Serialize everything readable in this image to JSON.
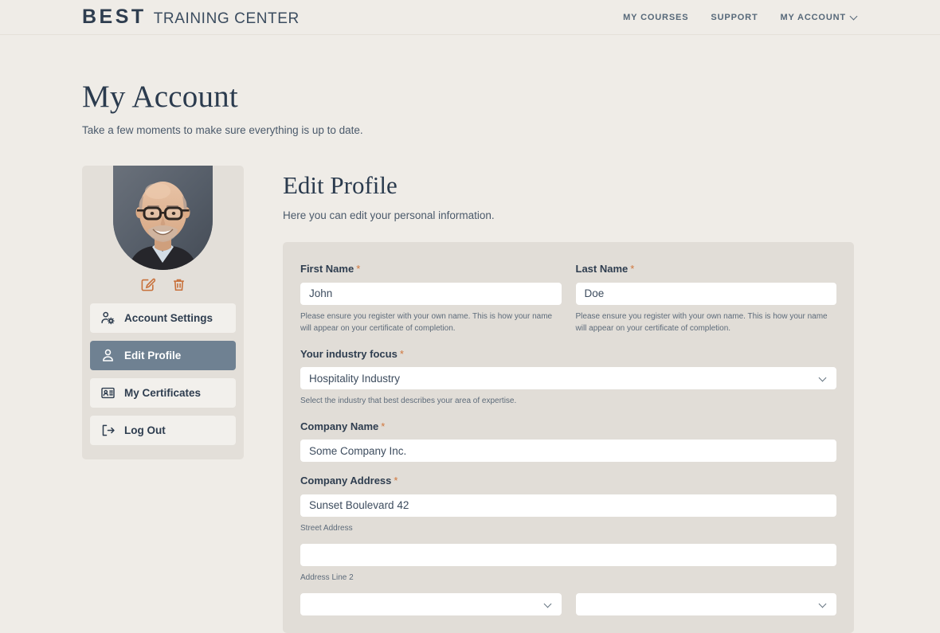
{
  "header": {
    "brand_mark": "BEST",
    "brand_rest": "TRAINING CENTER",
    "nav": [
      {
        "label": "MY COURSES",
        "has_caret": false
      },
      {
        "label": "SUPPORT",
        "has_caret": false
      },
      {
        "label": "MY ACCOUNT",
        "has_caret": true
      }
    ]
  },
  "page": {
    "title": "My Account",
    "subtitle": "Take a few moments to make sure everything is up to date."
  },
  "sidebar": {
    "avatar_alt": "user-avatar-photo",
    "avatar_actions": [
      {
        "name": "edit-avatar-icon",
        "label": "Edit photo",
        "color": "#c8703a"
      },
      {
        "name": "delete-avatar-icon",
        "label": "Delete photo",
        "color": "#c8703a"
      }
    ],
    "items": [
      {
        "label": "Account Settings",
        "icon": "account-settings-icon",
        "active": false
      },
      {
        "label": "Edit Profile",
        "icon": "user-icon",
        "active": true
      },
      {
        "label": "My Certificates",
        "icon": "id-card-icon",
        "active": false
      },
      {
        "label": "Log Out",
        "icon": "logout-icon",
        "active": false
      }
    ]
  },
  "main": {
    "title": "Edit Profile",
    "subtitle": "Here you can edit your personal information.",
    "fields": {
      "first_name": {
        "label": "First Name",
        "required_mark": "*",
        "value": "John",
        "help": "Please ensure you register with your own name. This is how your name will appear on your certificate of completion."
      },
      "last_name": {
        "label": "Last Name",
        "required_mark": "*",
        "value": "Doe",
        "help": "Please ensure you register with your own name. This is how your name will appear on your certificate of completion."
      },
      "industry_focus": {
        "label": "Your industry focus",
        "required_mark": "*",
        "value": "Hospitality Industry",
        "help": "Select the industry that best describes your area of expertise."
      },
      "company_name": {
        "label": "Company Name",
        "required_mark": "*",
        "value": "Some Company Inc."
      },
      "company_address": {
        "label": "Company Address",
        "required_mark": "*",
        "street": {
          "value": "Sunset Boulevard 42",
          "sublabel": "Street Address"
        },
        "line2": {
          "value": "",
          "sublabel": "Address Line 2"
        },
        "select_left": {
          "value": ""
        },
        "select_right": {
          "value": ""
        }
      }
    }
  },
  "colors": {
    "page_bg": "#efece7",
    "panel_bg": "#e1ddd7",
    "sidebar_bg": "#e3dfd9",
    "accent_active": "#6f8192",
    "accent_required": "#d0763c",
    "text_dark": "#2e3d4f"
  }
}
